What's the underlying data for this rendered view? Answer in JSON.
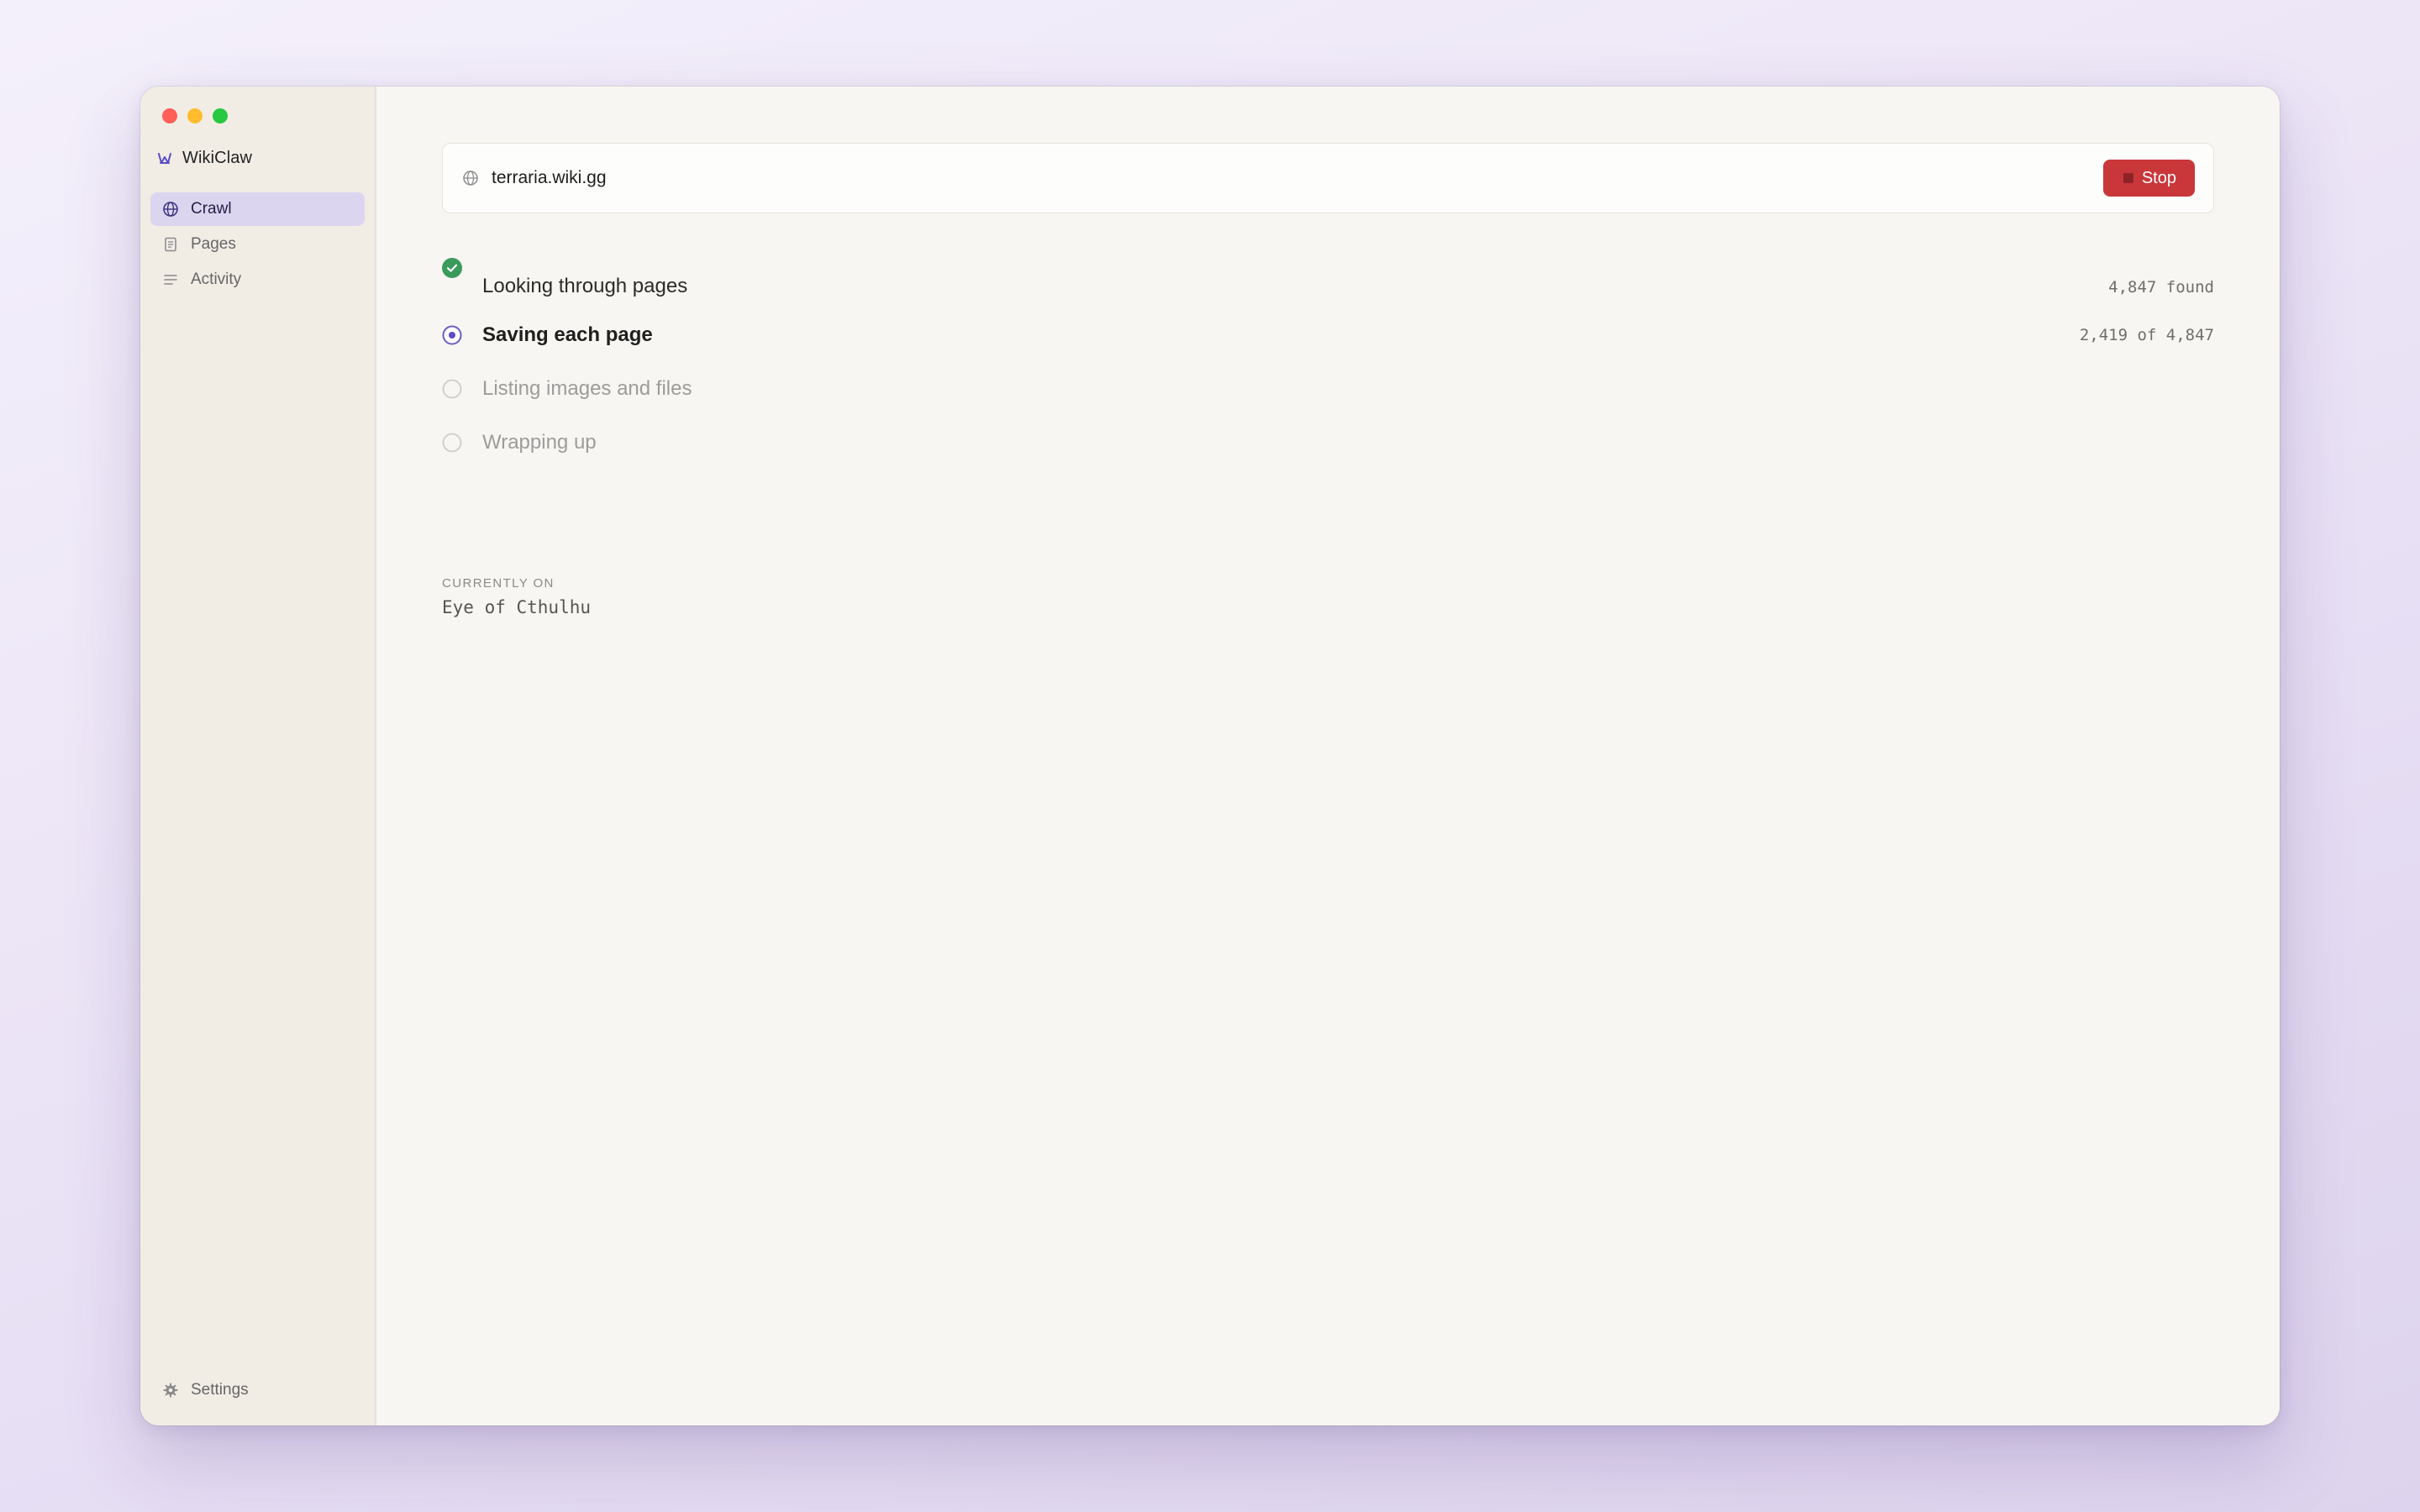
{
  "window": {
    "controls": [
      "close",
      "minimize",
      "zoom"
    ]
  },
  "app": {
    "name": "WikiClaw",
    "icon": "claw-icon",
    "accent": "#5b4bc4"
  },
  "sidebar": {
    "items": [
      {
        "label": "Crawl",
        "icon": "globe-icon",
        "active": true
      },
      {
        "label": "Pages",
        "icon": "document-icon",
        "active": false
      },
      {
        "label": "Activity",
        "icon": "list-icon",
        "active": false
      }
    ],
    "settings": {
      "label": "Settings",
      "icon": "gear-icon"
    }
  },
  "urlbar": {
    "icon": "globe-icon",
    "value": "terraria.wiki.gg",
    "stop_label": "Stop",
    "stop_color": "#c9373a"
  },
  "steps": [
    {
      "label": "Looking through pages",
      "status": "done",
      "count": "4,847 found"
    },
    {
      "label": "Saving each page",
      "status": "active",
      "count": "2,419 of 4,847"
    },
    {
      "label": "Listing images and files",
      "status": "pending",
      "count": ""
    },
    {
      "label": "Wrapping up",
      "status": "pending",
      "count": ""
    }
  ],
  "current": {
    "label": "CURRENTLY ON",
    "value": "Eye of Cthulhu"
  },
  "colors": {
    "done": "#3a9a5b",
    "active": "#6a5cc7",
    "pending": "#c9c9c9"
  }
}
